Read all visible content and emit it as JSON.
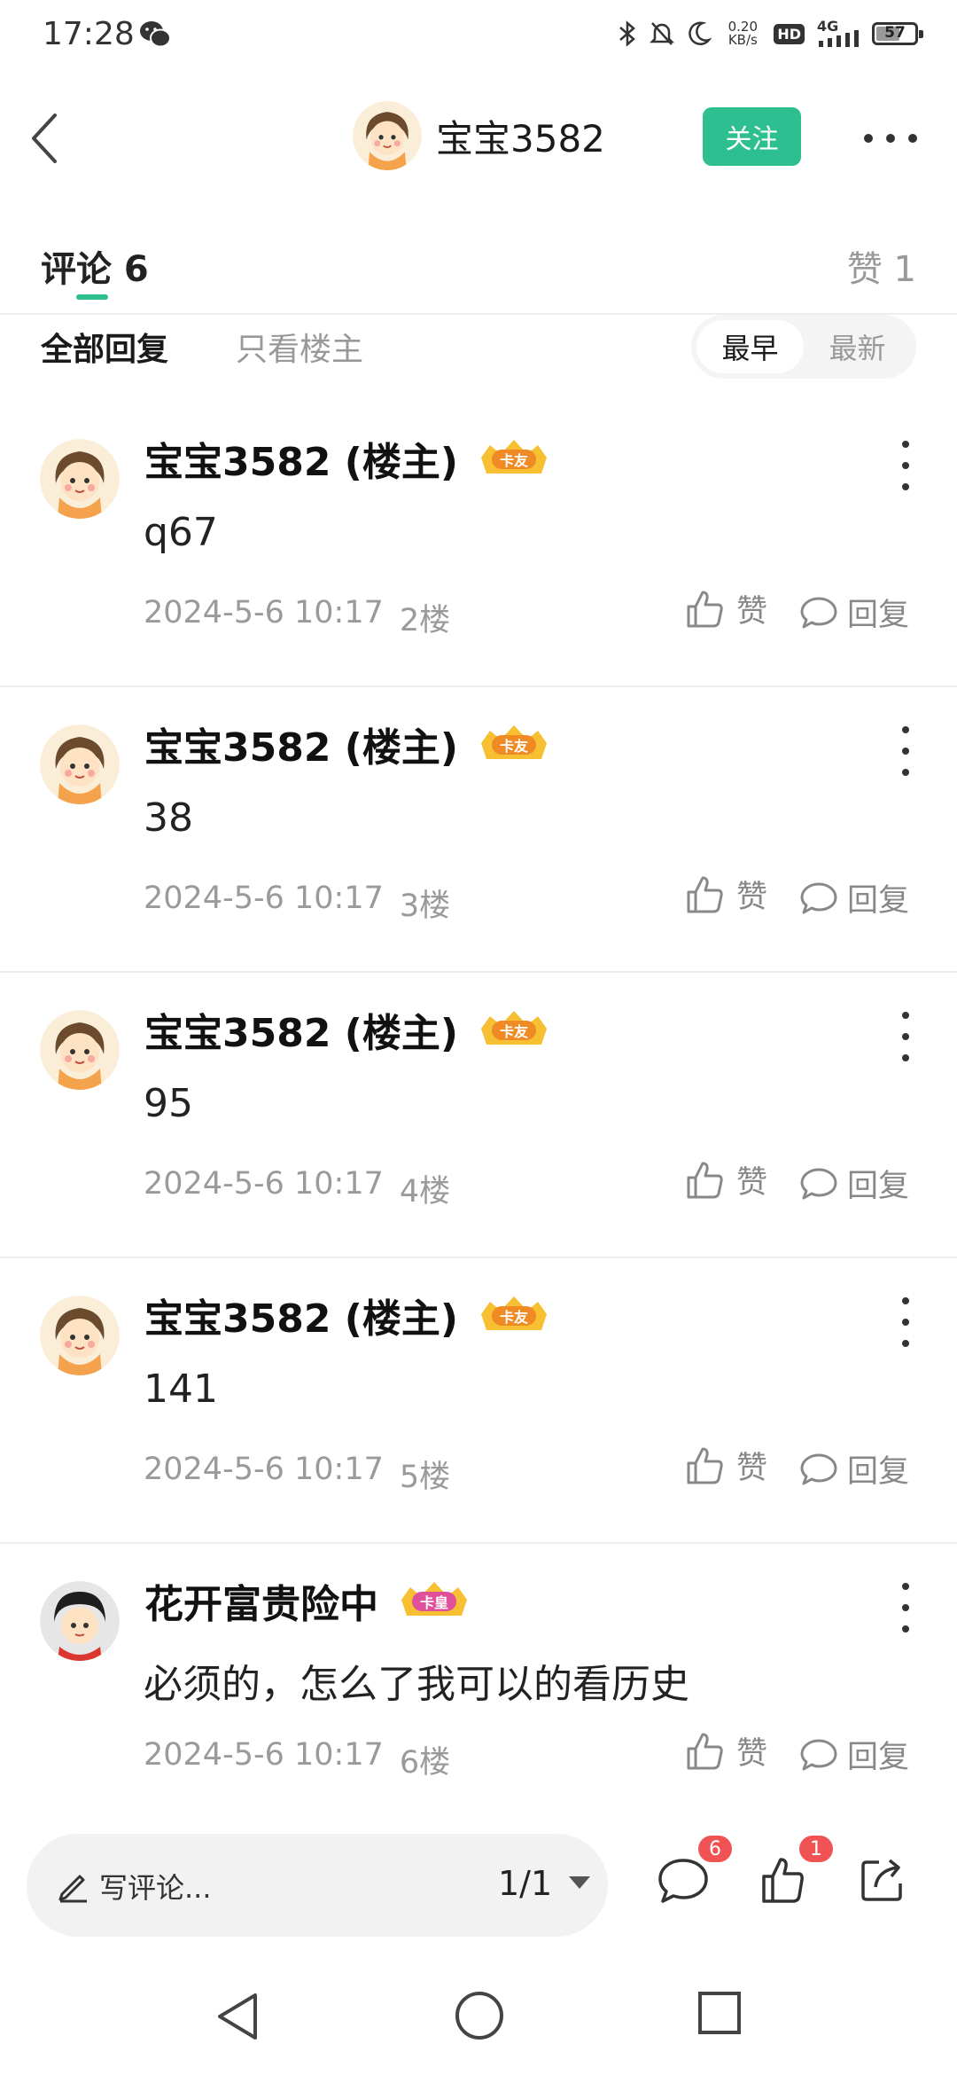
{
  "status_bar": {
    "time": "17:28",
    "net_speed_value": "0.20",
    "net_speed_unit": "KB/s",
    "hd": "HD",
    "network": "4G",
    "battery": "57",
    "icons": [
      "wechat-icon",
      "bluetooth-icon",
      "mute-icon",
      "moon-icon",
      "signal-icon",
      "battery-icon"
    ]
  },
  "header": {
    "username": "宝宝3582",
    "follow_label": "关注"
  },
  "tabs": {
    "comments_label": "评论 6",
    "likes_label": "赞 1"
  },
  "filters": {
    "all_replies": "全部回复",
    "op_only": "只看楼主",
    "sort_earliest": "最早",
    "sort_latest": "最新",
    "active_sort": "最早"
  },
  "colors": {
    "accent": "#2ebf91",
    "badge_red": "#f05353",
    "badge_orange": "#f08a24",
    "badge_pink": "#e0509a"
  },
  "comments": [
    {
      "name": "宝宝3582 (楼主)",
      "badge": "卡友",
      "text": "q67",
      "time": "2024-5-6 10:17",
      "floor": "2楼",
      "like": "赞",
      "reply": "回复"
    },
    {
      "name": "宝宝3582 (楼主)",
      "badge": "卡友",
      "text": "38",
      "time": "2024-5-6 10:17",
      "floor": "3楼",
      "like": "赞",
      "reply": "回复"
    },
    {
      "name": "宝宝3582 (楼主)",
      "badge": "卡友",
      "text": "95",
      "time": "2024-5-6 10:17",
      "floor": "4楼",
      "like": "赞",
      "reply": "回复"
    },
    {
      "name": "宝宝3582 (楼主)",
      "badge": "卡友",
      "text": "141",
      "time": "2024-5-6 10:17",
      "floor": "5楼",
      "like": "赞",
      "reply": "回复"
    },
    {
      "name": "花开富贵险中",
      "badge": "卡皇",
      "text": "必须的，怎么了我可以的看历史",
      "time": "2024-5-6 10:17",
      "floor": "6楼",
      "like": "赞",
      "reply": "回复"
    }
  ],
  "bottom_bar": {
    "write_placeholder": "写评论...",
    "page_indicator": "1/1",
    "comment_count": "6",
    "like_count": "1"
  }
}
